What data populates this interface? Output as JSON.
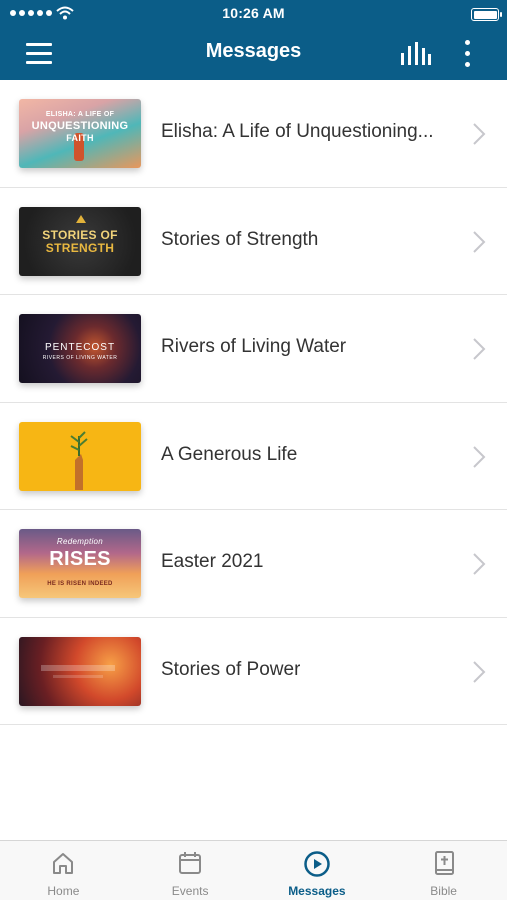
{
  "status_bar": {
    "time": "10:26 AM"
  },
  "header": {
    "title": "Messages",
    "menu_icon": "hamburger-icon",
    "audio_icon": "audio-bars-icon",
    "more_icon": "more-vertical-icon"
  },
  "messages": [
    {
      "title": "Elisha: A Life of Unquestioning...",
      "thumb_line1": "ELISHA: A LIFE OF",
      "thumb_line2": "UNQUESTIONING",
      "thumb_line3": "FAITH"
    },
    {
      "title": "Stories of Strength",
      "thumb_line1": "STORIES OF",
      "thumb_line2": "STRENGTH"
    },
    {
      "title": "Rivers of Living Water",
      "thumb_line1": "PENTECOST",
      "thumb_line2": "RIVERS OF LIVING WATER"
    },
    {
      "title": "A Generous Life"
    },
    {
      "title": "Easter 2021",
      "thumb_line1": "Redemption",
      "thumb_line2": "RISES",
      "thumb_line3": "HE IS RISEN INDEED"
    },
    {
      "title": "Stories of Power"
    }
  ],
  "tabs": [
    {
      "label": "Home",
      "icon": "home-icon",
      "active": false
    },
    {
      "label": "Events",
      "icon": "calendar-icon",
      "active": false
    },
    {
      "label": "Messages",
      "icon": "play-circle-icon",
      "active": true
    },
    {
      "label": "Bible",
      "icon": "bible-icon",
      "active": false
    }
  ],
  "colors": {
    "primary": "#0b5d88",
    "text": "#333333",
    "tab_inactive": "#8a8a8a"
  }
}
